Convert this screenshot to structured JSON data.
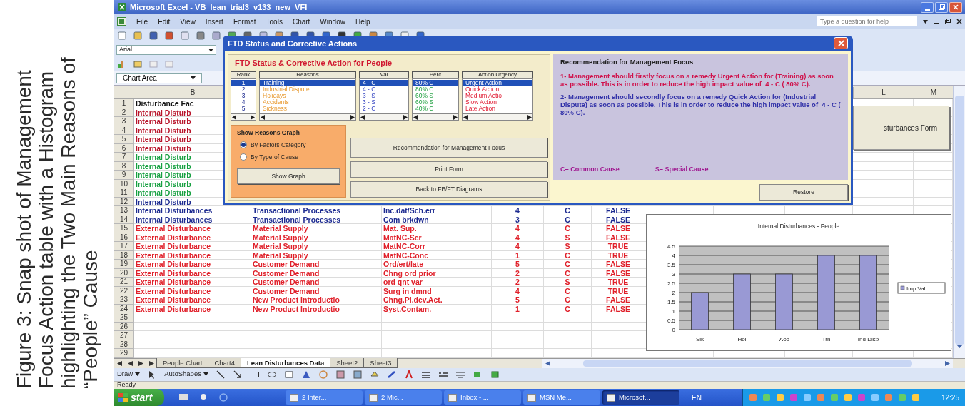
{
  "caption": "Figure 3: Snap shot of Management Focus Action table with a Histogram highlighting the Two Main Reasons of “People” Cause",
  "window": {
    "title": "Microsoft Excel - VB_lean_trial3_v133_new_VFI"
  },
  "menu": [
    "File",
    "Edit",
    "View",
    "Insert",
    "Format",
    "Tools",
    "Chart",
    "Window",
    "Help"
  ],
  "help_field": {
    "placeholder": "Type a question for help"
  },
  "font_box": "Arial",
  "name_box": "Chart Area",
  "column_headers": [
    "B",
    "L",
    "M"
  ],
  "rows": [
    {
      "number": "1",
      "color": "#111111",
      "cells": [
        "Disturbance Fac"
      ]
    },
    {
      "number": "2",
      "color": "#b8142a",
      "cells": [
        "Internal Disturb"
      ]
    },
    {
      "number": "3",
      "color": "#b8142a",
      "cells": [
        "Internal Disturb"
      ]
    },
    {
      "number": "4",
      "color": "#b8142a",
      "cells": [
        "Internal Disturb"
      ]
    },
    {
      "number": "5",
      "color": "#b8142a",
      "cells": [
        "Internal Disturb"
      ]
    },
    {
      "number": "6",
      "color": "#b8142a",
      "cells": [
        "Internal Disturb"
      ]
    },
    {
      "number": "7",
      "color": "#16a040",
      "cells": [
        "Internal Disturb"
      ]
    },
    {
      "number": "8",
      "color": "#16a040",
      "cells": [
        "Internal Disturb"
      ]
    },
    {
      "number": "9",
      "color": "#16a040",
      "cells": [
        "Internal Disturb"
      ]
    },
    {
      "number": "10",
      "color": "#16a040",
      "cells": [
        "Internal Disturb"
      ]
    },
    {
      "number": "11",
      "color": "#16a040",
      "cells": [
        "Internal Disturb"
      ]
    },
    {
      "number": "12",
      "color": "#1c2a90",
      "cells": [
        "Internal Disturb"
      ]
    },
    {
      "number": "13",
      "color": "#1c2a90",
      "cells": [
        "Internal Disturbances",
        "Transactional Processes",
        "Inc.dat/Sch.err",
        "4",
        "C",
        "FALSE"
      ]
    },
    {
      "number": "14",
      "color": "#1c2a90",
      "cells": [
        "Internal Disturbances",
        "Transactional Processes",
        "Com brkdwn",
        "3",
        "C",
        "FALSE"
      ]
    },
    {
      "number": "15",
      "color": "#e0202a",
      "cells": [
        "External Disturbance",
        "Material Supply",
        "Mat. Sup.",
        "4",
        "C",
        "FALSE"
      ]
    },
    {
      "number": "16",
      "color": "#e0202a",
      "cells": [
        "External Disturbance",
        "Material Supply",
        "MatNC-Scr",
        "4",
        "S",
        "FALSE"
      ]
    },
    {
      "number": "17",
      "color": "#e0202a",
      "cells": [
        "External Disturbance",
        "Material Supply",
        "MatNC-Corr",
        "4",
        "S",
        "TRUE"
      ]
    },
    {
      "number": "18",
      "color": "#e0202a",
      "cells": [
        "External Disturbance",
        "Material Supply",
        "MatNC-Conc",
        "1",
        "C",
        "TRUE"
      ]
    },
    {
      "number": "19",
      "color": "#e0202a",
      "cells": [
        "External Disturbance",
        "Customer Demand",
        "Ord/ert/late",
        "5",
        "C",
        "FALSE"
      ]
    },
    {
      "number": "20",
      "color": "#e0202a",
      "cells": [
        "External Disturbance",
        "Customer Demand",
        "Chng ord prior",
        "2",
        "C",
        "FALSE"
      ]
    },
    {
      "number": "21",
      "color": "#e0202a",
      "cells": [
        "External Disturbance",
        "Customer Demand",
        "ord qnt var",
        "2",
        "S",
        "TRUE"
      ]
    },
    {
      "number": "22",
      "color": "#e0202a",
      "cells": [
        "External Disturbance",
        "Customer Demand",
        "Surg in dmnd",
        "4",
        "C",
        "TRUE"
      ]
    },
    {
      "number": "23",
      "color": "#e0202a",
      "cells": [
        "External Disturbance",
        "New Product Introductio",
        "Chng.Pl.dev.Act.",
        "5",
        "C",
        "FALSE"
      ]
    },
    {
      "number": "24",
      "color": "#e0202a",
      "cells": [
        "External Disturbance",
        "New Product Introductio",
        "Syst.Contam.",
        "1",
        "C",
        "FALSE"
      ]
    },
    {
      "number": "25"
    },
    {
      "number": "26"
    },
    {
      "number": "27"
    },
    {
      "number": "28"
    },
    {
      "number": "29"
    }
  ],
  "side_button": "sturbances Form",
  "chart": {
    "chart_data": {
      "type": "bar",
      "title": "Internal Disturbances - People",
      "categories": [
        "Sik",
        "Hol",
        "Acc",
        "Trn",
        "Ind Disp"
      ],
      "series": [
        {
          "name": "Imp Val",
          "color": "#9999d4",
          "values": [
            2,
            3,
            3,
            4,
            4
          ]
        }
      ],
      "grid": true,
      "ylim": [
        0,
        4.5
      ],
      "yticks": [
        0,
        0.5,
        1,
        1.5,
        2,
        2.5,
        3,
        3.5,
        4,
        4.5
      ]
    }
  },
  "sheet_tabs": [
    {
      "label": "People Chart",
      "selected": false
    },
    {
      "label": "Chart4",
      "selected": false
    },
    {
      "label": "Lean Disturbances Data",
      "selected": true
    },
    {
      "label": "Sheet2",
      "selected": false
    },
    {
      "label": "Sheet3",
      "selected": false
    }
  ],
  "draw_toolbar": {
    "draw": "Draw",
    "autoshapes": "AutoShapes"
  },
  "status": "Ready",
  "taskbar": {
    "start": "start",
    "buttons": [
      {
        "label": "2 Inter...",
        "selected": false
      },
      {
        "label": "2 Mic...",
        "selected": false
      },
      {
        "label": "Inbox - ...",
        "selected": false
      },
      {
        "label": "MSN Me...",
        "selected": false
      },
      {
        "label": "Microsof...",
        "selected": true
      }
    ],
    "language": "EN",
    "clock": "12:25"
  },
  "dialog": {
    "title": "FTD Status and Corrective Actions",
    "heading": "FTD Status & Corrective Action for People",
    "columns": [
      {
        "label": "Rank"
      },
      {
        "label": "Reasons"
      },
      {
        "label": "Val"
      },
      {
        "label": "Perc"
      },
      {
        "label": "Action Urgency"
      }
    ],
    "rows": [
      {
        "cells": [
          "1",
          "Training",
          "4 - C",
          "80% C",
          "Urgent Action"
        ],
        "selected": true
      },
      {
        "cells": [
          "2",
          "Industrial Dispute",
          "4 - C",
          "80% C",
          "Quick Action"
        ],
        "selected": false
      },
      {
        "cells": [
          "3",
          "Holidays",
          "3 - S",
          "60% S",
          "Medium Actio"
        ],
        "selected": false
      },
      {
        "cells": [
          "4",
          "Accidents",
          "3 - S",
          "60% S",
          "Slow Action"
        ],
        "selected": false
      },
      {
        "cells": [
          "5",
          "Sickness",
          "2 - C",
          "40% C",
          "Late Action"
        ],
        "selected": false
      }
    ],
    "graph_group": {
      "title": "Show Reasons Graph",
      "options": [
        {
          "label": "By Factors Category",
          "selected": true
        },
        {
          "label": "By Type of Cause",
          "selected": false
        }
      ],
      "button": "Show Graph"
    },
    "buttons": [
      "Recommendation for Management Focus",
      "Print Form",
      "Back to FB/FT Diagrams"
    ],
    "recommendation": {
      "title": "Recommendation for Management Focus",
      "paragraphs": [
        {
          "text": "1- Management should firstly focus on a remedy Urgent Action for (Training) as soon as possible. This is in order to reduce the high impact value of  4 - C ( 80% C).",
          "color": "#d0104a"
        },
        {
          "text": "2- Management should secondly focus on a remedy Quick Action for (Industrial Dispute) as soon as possible. This is in order to reduce the high impact value of  4 - C ( 80% C).",
          "color": "#3030a8"
        }
      ],
      "legend": [
        "C= Common Cause",
        "S= Special Cause"
      ]
    },
    "restore": "Restore"
  }
}
